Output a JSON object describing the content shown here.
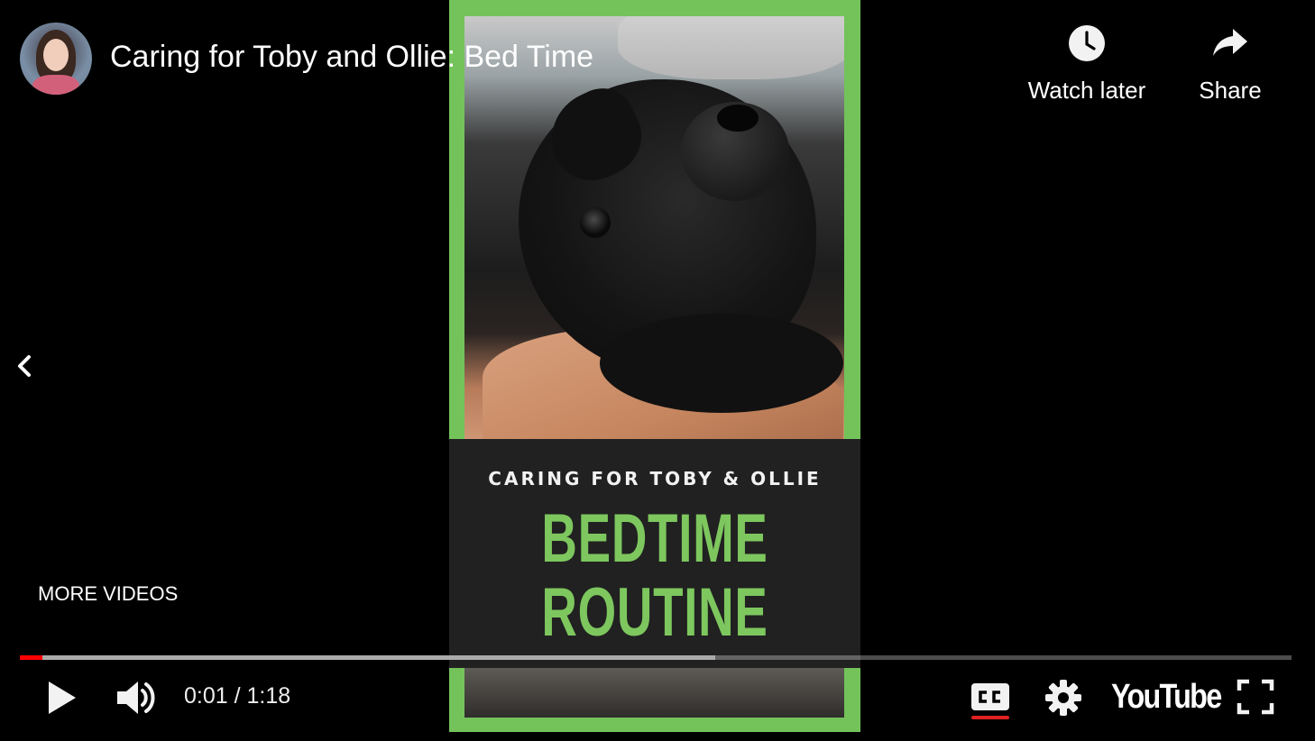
{
  "header": {
    "video_title": "Caring for Toby and Ollie: Bed Time",
    "watch_later_label": "Watch later",
    "share_label": "Share"
  },
  "video": {
    "card_subtitle": "CARING FOR TOBY & OLLIE",
    "card_headline_line1": "BEDTIME",
    "card_headline_line2": "ROUTINE"
  },
  "more_videos_label": "MORE VIDEOS",
  "controls": {
    "time_display": "0:01 / 1:18",
    "youtube_logo": "YouTube",
    "progress_played_fraction": 0.018,
    "progress_buffered_fraction": 0.547
  },
  "icons": {
    "play": "play-icon",
    "volume": "volume-icon",
    "cc": "closed-captions-icon",
    "settings": "gear-icon",
    "fullscreen": "fullscreen-icon",
    "watch_later": "clock-icon",
    "share": "share-arrow-icon",
    "back": "chevron-left-icon"
  },
  "colors": {
    "progress_played": "#ff0000",
    "card_accent": "#7dc75e",
    "frame_border": "#73c35a",
    "cc_underline": "#e02020"
  }
}
